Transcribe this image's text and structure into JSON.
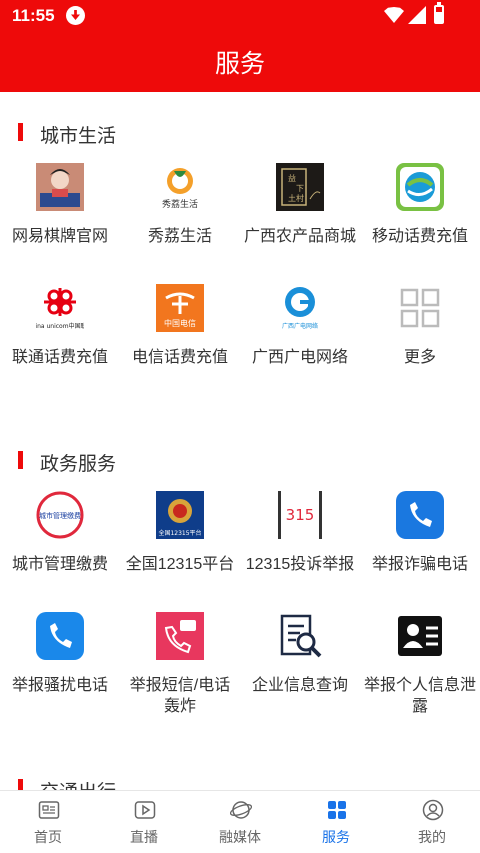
{
  "status_bar": {
    "time": "11:55"
  },
  "header": {
    "title": "服务"
  },
  "sections": [
    {
      "title": "城市生活",
      "items": [
        {
          "label": "网易棋牌官网",
          "icon": "netease-chess-icon"
        },
        {
          "label": "秀荔生活",
          "icon": "xiuli-life-icon"
        },
        {
          "label": "广西农产品商城",
          "icon": "guangxi-farm-mall-icon"
        },
        {
          "label": "移动话费充值",
          "icon": "china-mobile-icon"
        },
        {
          "label": "联通话费充值",
          "icon": "china-unicom-icon"
        },
        {
          "label": "电信话费充值",
          "icon": "china-telecom-icon"
        },
        {
          "label": "广西广电网络",
          "icon": "guangxi-broadcast-icon"
        },
        {
          "label": "更多",
          "icon": "more-grid-icon"
        }
      ]
    },
    {
      "title": "政务服务",
      "items": [
        {
          "label": "城市管理缴费",
          "icon": "city-management-icon"
        },
        {
          "label": "全国12315平台",
          "icon": "national-12315-icon"
        },
        {
          "label": "12315投诉举报",
          "icon": "complaint-12315-icon"
        },
        {
          "label": "举报诈骗电话",
          "icon": "report-fraud-call-icon"
        },
        {
          "label": "举报骚扰电话",
          "icon": "report-harass-call-icon"
        },
        {
          "label": "举报短信/电话轰炸",
          "icon": "report-sms-bomb-icon"
        },
        {
          "label": "企业信息查询",
          "icon": "enterprise-search-icon"
        },
        {
          "label": "举报个人信息泄露",
          "icon": "report-privacy-leak-icon"
        }
      ]
    },
    {
      "title": "交通出行",
      "items": []
    }
  ],
  "icon_texts": {
    "xiuli": "秀荔生活",
    "farm": [
      "益",
      "下",
      "土",
      "村"
    ],
    "unicom_logo": "China unicom中国联通",
    "telecom_logo": "中国电信",
    "broadcast_logo": "广西广电网络",
    "city_logo": "城市管理缴费",
    "national_logo": "全国12315平台",
    "num_315": "315"
  },
  "tabs": [
    {
      "label": "首页",
      "icon": "newspaper-icon",
      "active": false
    },
    {
      "label": "直播",
      "icon": "play-icon",
      "active": false
    },
    {
      "label": "融媒体",
      "icon": "planet-icon",
      "active": false
    },
    {
      "label": "服务",
      "icon": "grid-icon",
      "active": true
    },
    {
      "label": "我的",
      "icon": "user-icon",
      "active": false
    }
  ],
  "colors": {
    "brand_red": "#ee0a0a",
    "active_blue": "#1a73e8"
  }
}
